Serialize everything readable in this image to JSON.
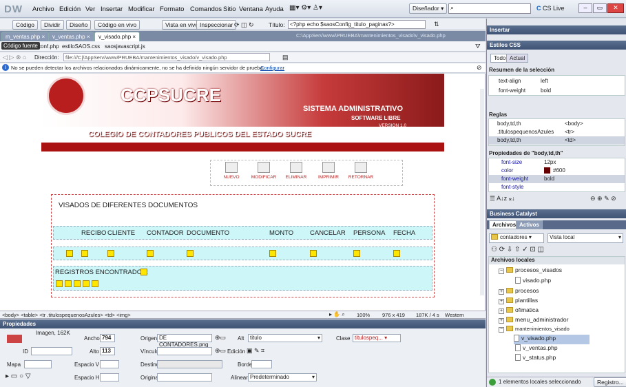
{
  "app": {
    "logo": "DW",
    "menus": [
      "Archivo",
      "Edición",
      "Ver",
      "Insertar",
      "Modificar",
      "Formato",
      "Comandos",
      "Sitio",
      "Ventana",
      "Ayuda"
    ],
    "workspace": "Diseñador",
    "cslive": "CS Live"
  },
  "doc_toolbar": {
    "code": "Código",
    "split": "Dividir",
    "design": "Diseño",
    "code_live": "Código en vivo",
    "live_view": "Vista en vivo",
    "inspect": "Inspeccionar",
    "title_label": "Título:",
    "title_value": "<?php echo $saosConfig_titulo_paginas?>"
  },
  "doc_tabs": [
    "m_ventas.php",
    "v_ventas.php",
    "v_visado.php"
  ],
  "path_right": "C:\\AppServ\\www\\PRUEBA\\mantenimientos_visado\\v_visado.php",
  "related": {
    "source": "Código fuente",
    "files": [
      "conf.php",
      "estiloSAOS.css",
      "saosjavascript.js"
    ]
  },
  "address": {
    "label": "Dirección:",
    "value": "file:///C|/AppServ/www/PRUEBA/mantenimientos_visado/v_visado.php"
  },
  "info_bar": {
    "text": "No se pueden detectar los archivos relacionados dinámicamente, no se ha definido ningún servidor de prueba.",
    "link": "Configurar"
  },
  "page": {
    "logo_text": "CCPSUCRE",
    "subtitle": "COLEGIO DE CONTADORES PUBLICOS DEL ESTADO SUCRE",
    "sistema": "SISTEMA ADMINISTRATIVO",
    "software": "SOFTWARE LIBRE",
    "version": "VERSION 1.0",
    "actions": [
      "NUEVO",
      "MODIFICAR",
      "ELIMINAR",
      "IMPRIMIR",
      "RETORNAR"
    ],
    "section_title": "VISADOS DE DIFERENTES DOCUMENTOS",
    "columns": [
      "RECIBO",
      "CLIENTE",
      "CONTADOR",
      "DOCUMENTO",
      "MONTO",
      "CANCELAR",
      "PERSONA",
      "FECHA"
    ],
    "registros": "REGISTROS ENCONTRADOS:"
  },
  "status": {
    "tags": "<body> <table> <tr .titulospequenosAzules> <td> <img>",
    "zoom": "100%",
    "size": "976 x 419",
    "weight": "187K / 4 s",
    "encoding": "Western European"
  },
  "props": {
    "header": "Propiedades",
    "type": "Imagen, 162K",
    "ancho_label": "Ancho",
    "ancho": "794",
    "alto_label": "Alto",
    "alto": "113",
    "id_label": "ID",
    "origen_label": "Origen",
    "origen": "DE CONTADORES.png",
    "vinculo_label": "Vínculo",
    "alt_label": "Alt",
    "alt": "titulo",
    "clase_label": "Clase",
    "clase": "titulospeq...",
    "edicion_label": "Edición",
    "mapa_label": "Mapa",
    "espacio_v": "Espacio V",
    "espacio_h": "Espacio H",
    "destino": "Destino",
    "original": "Original",
    "borde": "Borde",
    "alinear_label": "Alinear",
    "alinear": "Predeterminado"
  },
  "right": {
    "insertar": "Insertar",
    "estilos": "Estilos CSS",
    "todo": "Todo",
    "actual": "Actual",
    "resumen": "Resumen de la selección",
    "summary": [
      [
        "text-align",
        "left"
      ],
      [
        "font-weight",
        "bold"
      ]
    ],
    "reglas": "Reglas",
    "rules": [
      [
        "body,td,th",
        "<body>"
      ],
      [
        ".titulospequenosAzules",
        "<tr>"
      ],
      [
        "body,td,th",
        "<td>"
      ]
    ],
    "propiedades": "Propiedades de \"body,td,th\"",
    "properties": [
      [
        "font-size",
        "12px"
      ],
      [
        "color",
        "#600"
      ],
      [
        "font-weight",
        "bold"
      ],
      [
        "font-style",
        ""
      ]
    ],
    "business": "Business Catalyst",
    "archivos": "Archivos",
    "activos": "Activos",
    "site": "contadores",
    "view": "Vista local",
    "archivos_locales": "Archivos locales",
    "tree": [
      "procesos_visados",
      "visado.php",
      "procesos",
      "plantillas",
      "ofimatica",
      "menu_administrador",
      "mantenimientos_visado",
      "v_visado.php",
      "v_ventas.php",
      "v_status.php"
    ],
    "footer": "1 elementos locales seleccionado",
    "registro": "Registro..."
  },
  "colors": {
    "accent": "#a11111",
    "cyan": "#ccf6f8",
    "panel": "#3e5275"
  }
}
